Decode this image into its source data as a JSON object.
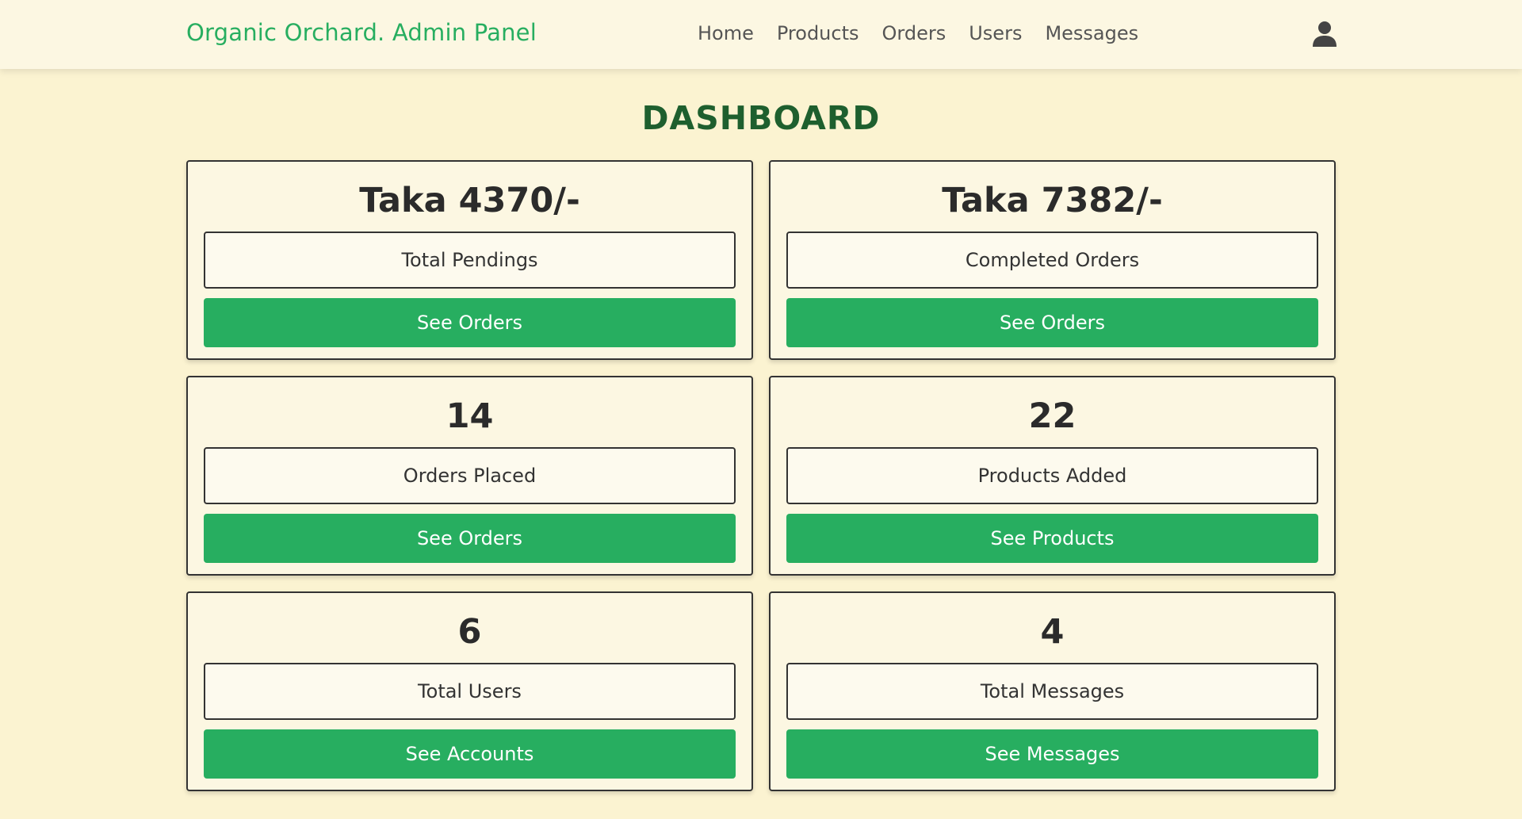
{
  "header": {
    "brand": "Organic Orchard. Admin Panel",
    "nav": [
      "Home",
      "Products",
      "Orders",
      "Users",
      "Messages"
    ],
    "user_icon": "user-icon"
  },
  "page": {
    "title": "DASHBOARD"
  },
  "cards": [
    {
      "value": "Taka 4370/-",
      "label": "Total Pendings",
      "button": "See Orders"
    },
    {
      "value": "Taka 7382/-",
      "label": "Completed Orders",
      "button": "See Orders"
    },
    {
      "value": "14",
      "label": "Orders Placed",
      "button": "See Orders"
    },
    {
      "value": "22",
      "label": "Products Added",
      "button": "See Products"
    },
    {
      "value": "6",
      "label": "Total Users",
      "button": "See Accounts"
    },
    {
      "value": "4",
      "label": "Total Messages",
      "button": "See Messages"
    }
  ],
  "colors": {
    "background": "#fbf3d1",
    "header": "#fcf7e2",
    "accent": "#27ae60",
    "title": "#1e5f2e"
  }
}
